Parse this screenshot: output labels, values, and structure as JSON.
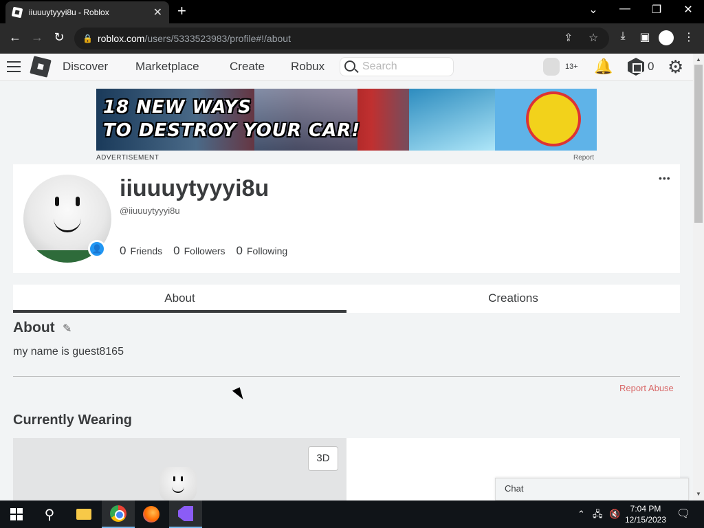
{
  "browser": {
    "tab_title": "iiuuuytyyyi8u - Roblox",
    "tab_close": "✕",
    "new_tab": "+",
    "url_host": "roblox.com",
    "url_path": "/users/5333523983/profile#!/about",
    "window_controls": [
      "⌄",
      "—",
      "❐",
      "✕"
    ]
  },
  "header": {
    "nav": [
      "Discover",
      "Marketplace",
      "Create",
      "Robux"
    ],
    "search_placeholder": "Search",
    "age_badge": "13+",
    "robux_count": "0"
  },
  "ad": {
    "headline_line1": "18 NEW WAYS",
    "headline_line2": "TO DESTROY YOUR CAR!",
    "label": "ADVERTISEMENT",
    "report": "Report"
  },
  "profile": {
    "display_name": "iiuuuytyyyi8u",
    "username": "@iiuuuytyyyi8u",
    "stats": [
      {
        "count": "0",
        "label": "Friends"
      },
      {
        "count": "0",
        "label": "Followers"
      },
      {
        "count": "0",
        "label": "Following"
      }
    ],
    "more_menu": "•••"
  },
  "tabs": {
    "about": "About",
    "creations": "Creations"
  },
  "about": {
    "heading": "About",
    "text": "my name is guest8165",
    "report_abuse": "Report Abuse"
  },
  "wearing": {
    "heading": "Currently Wearing",
    "button_3d": "3D"
  },
  "chat": {
    "label": "Chat"
  },
  "taskbar": {
    "time": "7:04 PM",
    "date": "12/15/2023"
  }
}
